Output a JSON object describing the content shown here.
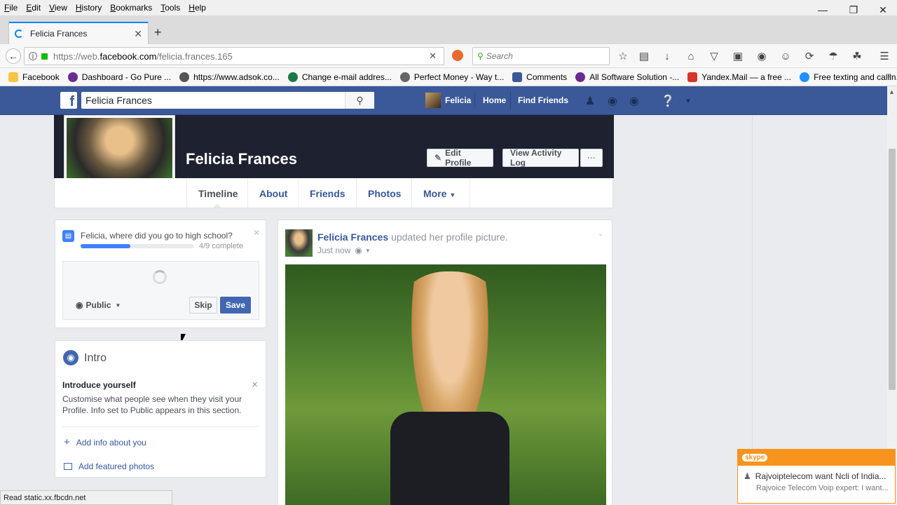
{
  "menubar": {
    "items": [
      "File",
      "Edit",
      "View",
      "History",
      "Bookmarks",
      "Tools",
      "Help"
    ]
  },
  "tab": {
    "title": "Felicia Frances"
  },
  "urlbar": {
    "url_prefix": "https://web.",
    "url_domain": "facebook.com",
    "url_path": "/felicia.frances.165"
  },
  "searchbar": {
    "placeholder": "Search"
  },
  "bookmarks": [
    {
      "label": "Facebook",
      "color": "#f4c542"
    },
    {
      "label": "Dashboard - Go Pure ...",
      "color": "#6a2c91"
    },
    {
      "label": "https://www.adsok.co...",
      "color": "#555555"
    },
    {
      "label": "Change e-mail addres...",
      "color": "#1a7a4c"
    },
    {
      "label": "Perfect Money - Way t...",
      "color": "#666666"
    },
    {
      "label": "Comments",
      "color": "#3b5998"
    },
    {
      "label": "All Software Solution -...",
      "color": "#6a2c91"
    },
    {
      "label": "Yandex.Mail — a free ...",
      "color": "#d9342b"
    },
    {
      "label": "Free texting and callin...",
      "color": "#1e90ff"
    }
  ],
  "fb": {
    "search_value": "Felicia Frances",
    "nav": {
      "user": "Felicia",
      "home": "Home",
      "find_friends": "Find Friends"
    },
    "profile_name": "Felicia Frances",
    "edit_profile": "Edit Profile",
    "activity_log": "View Activity Log",
    "more_dots": "···",
    "tabs": [
      "Timeline",
      "About",
      "Friends",
      "Photos",
      "More"
    ]
  },
  "question": {
    "text": "Felicia, where did you go to high school?",
    "progress_text": "4/9 complete",
    "progress": 0.44,
    "audience": "Public",
    "skip": "Skip",
    "save": "Save"
  },
  "intro": {
    "title": "Intro",
    "heading": "Introduce yourself",
    "body_line1": "Customise what people see when they visit your",
    "body_line2": "Profile. Info set to Public appears in this section.",
    "add_info": "Add info about you",
    "add_photos": "Add featured photos"
  },
  "post": {
    "author": "Felicia Frances",
    "action": "updated her profile picture.",
    "time": "Just now"
  },
  "status_bar": "Read static.xx.fbcdn.net",
  "skype": {
    "logo": "skype",
    "title": "Rajvoiptelecom want Ncli of India...",
    "subtitle": "Rajvoice Telecom Voip expert: I want..."
  }
}
